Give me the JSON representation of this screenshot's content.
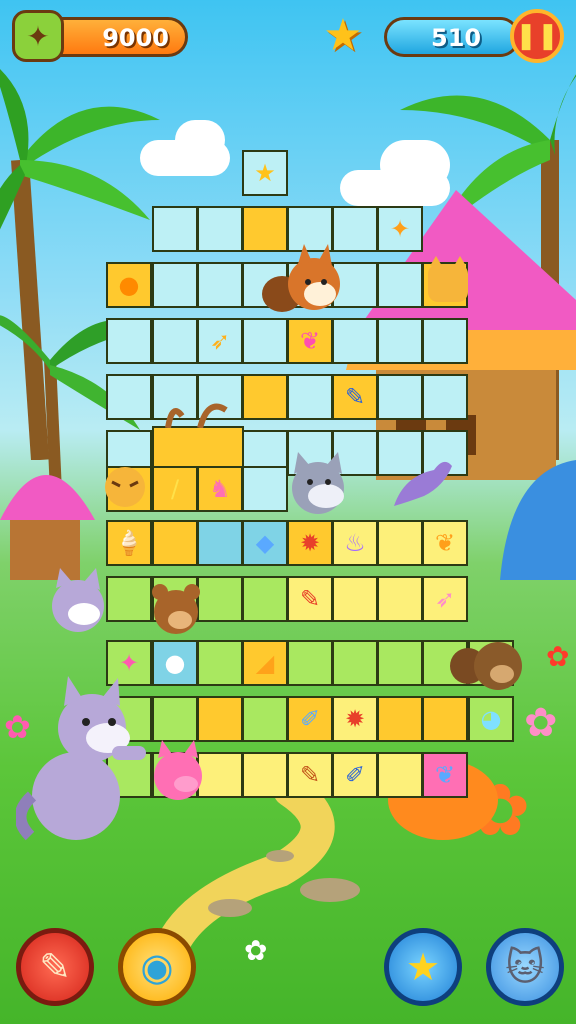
{
  "hud": {
    "score": "9000",
    "moves": "510",
    "icons": {
      "ticket": "ticket-icon",
      "star": "star-icon",
      "pause": "pause-icon"
    }
  },
  "board": {
    "icons": [
      "chick-icon",
      "leaf-icon",
      "wolf-face-icon",
      "chick-icon",
      "star-sticker-icon",
      "bird-icon",
      "crayon-icon",
      "lamb-icon",
      "fish-icon",
      "ice-cream-icon",
      "crab-icon",
      "cup-icon",
      "bird-icon",
      "pencil-icon",
      "feather-icon",
      "snowball-icon",
      "popsicle-icon",
      "crab-icon",
      "pencil-icon",
      "paintbrush-icon",
      "seal-icon",
      "bird-icon"
    ]
  },
  "buttons": {
    "left_primary": "pencil-booster-icon",
    "left_secondary": "rainbow-ball-icon",
    "right_primary": "magic-wand-icon",
    "right_secondary": "cat-helper-icon"
  },
  "colors": {
    "score_pill": "#ff7a10",
    "moves_pill": "#20a6e0",
    "pause": "#e8402a",
    "grass": "#5cc63a",
    "sky": "#3fc4f2"
  }
}
